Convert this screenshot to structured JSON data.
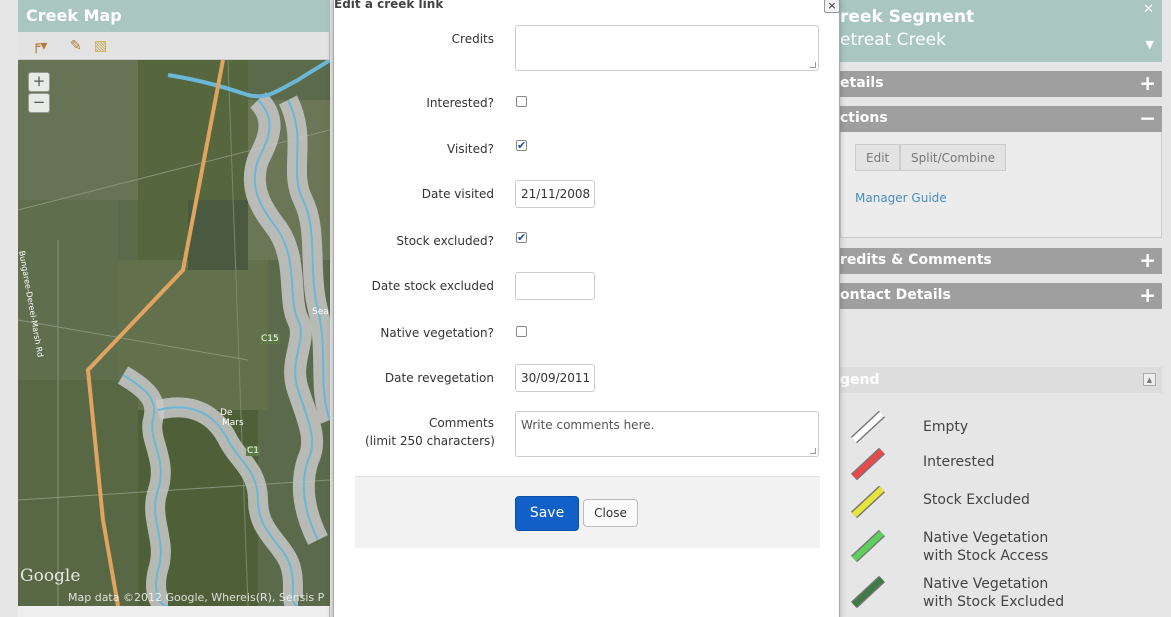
{
  "map_panel": {
    "title": "Creek Map",
    "zoom_in": "+",
    "zoom_out": "−",
    "google_logo": "Google",
    "map_data": "Map data ©2012 Google, Whereis(R), Sensis P",
    "road_label": "Bungaree-Dereel-Marsh Rd",
    "c15_label_1": "C15",
    "c15_label_2": "C1",
    "town_label_1": "De",
    "town_label_2": "Mars",
    "seal_label": "Sea"
  },
  "modal": {
    "title": "Edit a creek link",
    "close_x": "×",
    "fields": {
      "credits_label": "Credits",
      "credits_value": "",
      "interested_label": "Interested?",
      "visited_label": "Visited?",
      "date_visited_label": "Date visited",
      "date_visited_value": "21/11/2008",
      "stock_excluded_label": "Stock excluded?",
      "date_stock_excluded_label": "Date stock excluded",
      "date_stock_excluded_value": "",
      "native_veg_label": "Native vegetation?",
      "date_reveg_label": "Date revegetation",
      "date_reveg_value": "30/09/2011",
      "comments_label_1": "Comments",
      "comments_label_2": "(limit 250 characters)",
      "comments_value": "Write comments here."
    },
    "checks": {
      "interested": false,
      "visited": true,
      "stock_excluded": true,
      "native_vegetation": false
    },
    "save_label": "Save",
    "close_label": "Close"
  },
  "right_panel": {
    "segment_heading": "reek Segment",
    "segment_name": "etreat Creek",
    "details_label": "etails",
    "actions_label": "ctions",
    "edit_label": "Edit",
    "split_label": "Split/Combine",
    "guide_label": "Manager Guide",
    "credits_label": "redits & Comments",
    "contact_label": "ontact Details",
    "legend_label": "gend",
    "legend": [
      {
        "label_1": "Empty",
        "label_2": "",
        "color": "#ffffff"
      },
      {
        "label_1": "Interested",
        "label_2": "",
        "color": "#e84a4a"
      },
      {
        "label_1": "Stock Excluded",
        "label_2": "",
        "color": "#e8e53a"
      },
      {
        "label_1": "Native Vegetation",
        "label_2": "with Stock Access",
        "color": "#5dcf5d"
      },
      {
        "label_1": "Native Vegetation",
        "label_2": "with Stock Excluded",
        "color": "#3d7a45"
      }
    ]
  }
}
